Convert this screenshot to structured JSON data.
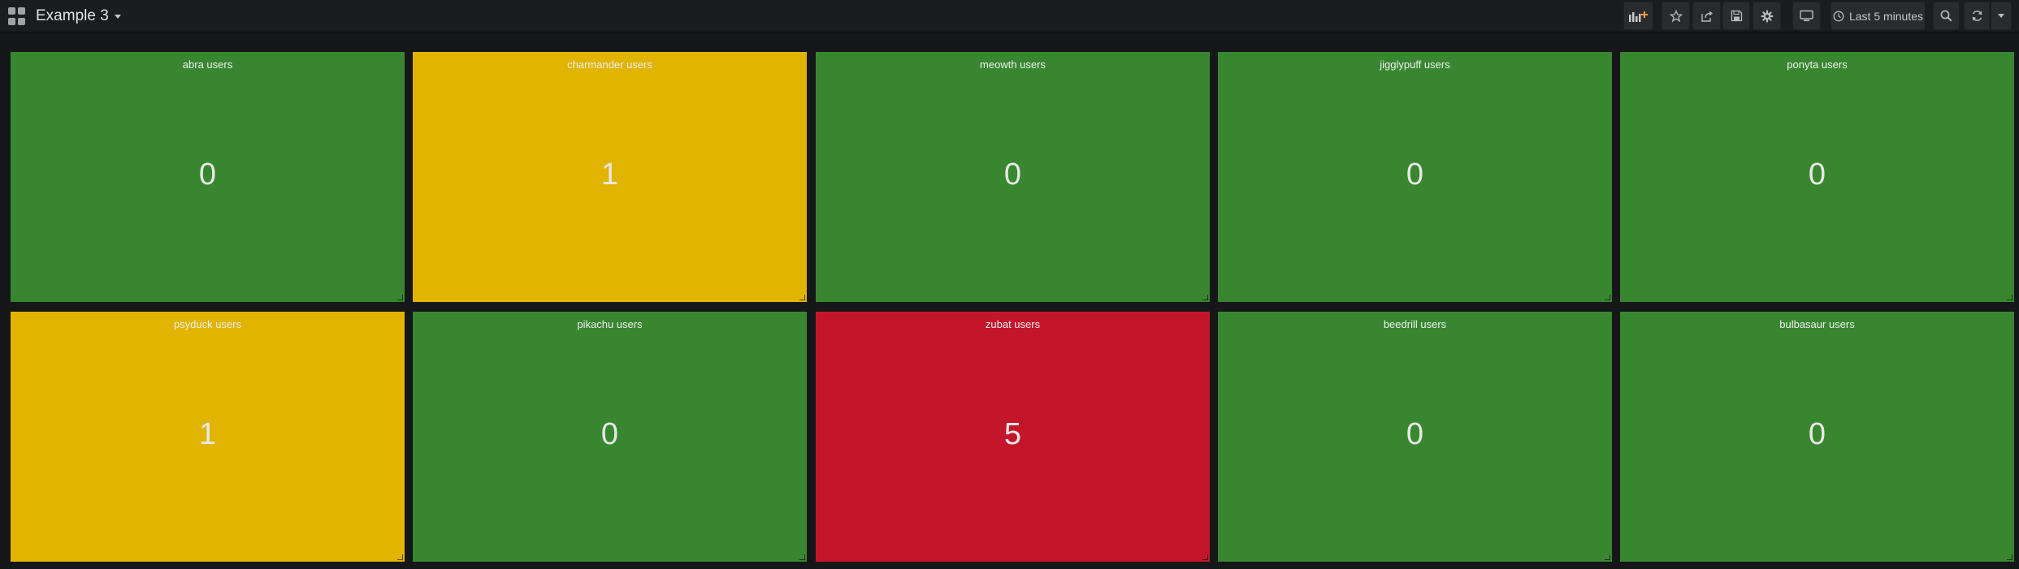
{
  "dashboard": {
    "title": "Example 3"
  },
  "toolbar": {
    "time_range": "Last 5 minutes",
    "icons": [
      "add-panel-icon",
      "star-icon",
      "share-icon",
      "save-icon",
      "settings-icon",
      "tv-mode-icon",
      "clock-icon",
      "zoom-out-icon",
      "refresh-icon",
      "caret-down-icon"
    ]
  },
  "colors": {
    "ok": "#388730",
    "warning": "#e0b400",
    "critical": "#c4162a"
  },
  "panels": [
    {
      "title": "abra users",
      "value": "0",
      "status": "ok"
    },
    {
      "title": "charmander users",
      "value": "1",
      "status": "warning"
    },
    {
      "title": "meowth users",
      "value": "0",
      "status": "ok"
    },
    {
      "title": "jigglypuff users",
      "value": "0",
      "status": "ok"
    },
    {
      "title": "ponyta users",
      "value": "0",
      "status": "ok"
    },
    {
      "title": "psyduck users",
      "value": "1",
      "status": "warning"
    },
    {
      "title": "pikachu users",
      "value": "0",
      "status": "ok"
    },
    {
      "title": "zubat users",
      "value": "5",
      "status": "critical"
    },
    {
      "title": "beedrill users",
      "value": "0",
      "status": "ok"
    },
    {
      "title": "bulbasaur users",
      "value": "0",
      "status": "ok"
    }
  ]
}
